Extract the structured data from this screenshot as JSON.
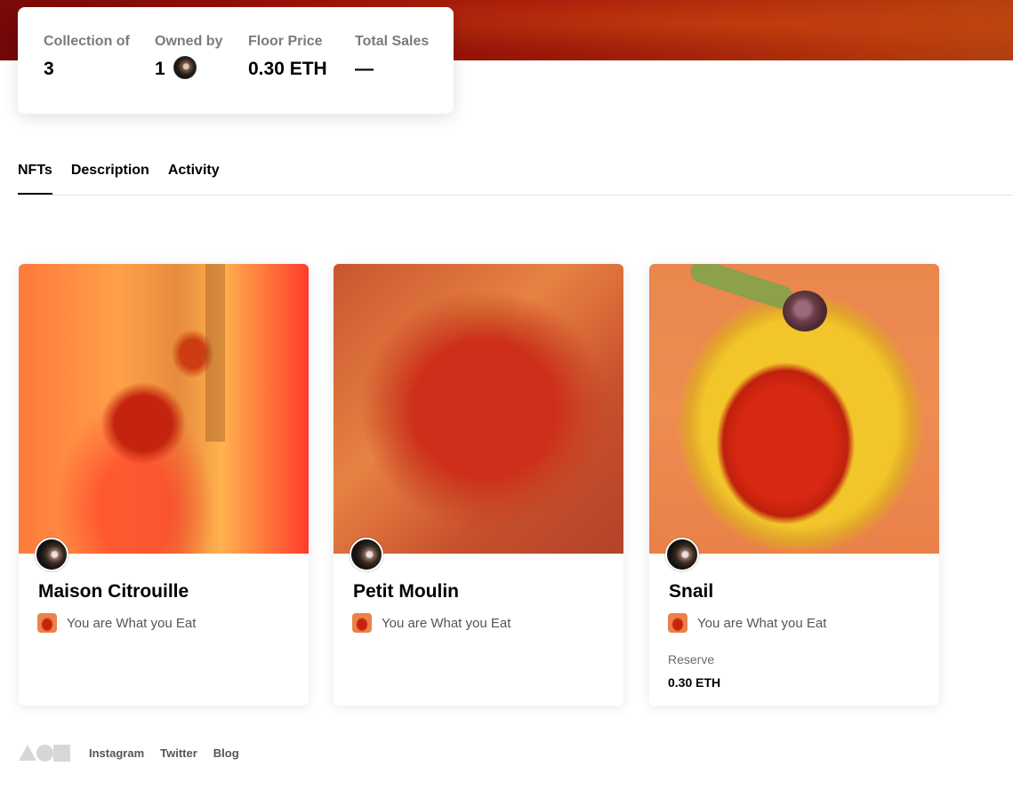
{
  "stats": {
    "collection_of": {
      "label": "Collection of",
      "value": "3"
    },
    "owned_by": {
      "label": "Owned by",
      "value": "1",
      "avatar_icon": "owner-avatar-icon"
    },
    "floor_price": {
      "label": "Floor Price",
      "value": "0.30 ETH"
    },
    "total_sales": {
      "label": "Total Sales",
      "value": "—"
    }
  },
  "tabs": [
    {
      "label": "NFTs",
      "active": true
    },
    {
      "label": "Description",
      "active": false
    },
    {
      "label": "Activity",
      "active": false
    }
  ],
  "cards": [
    {
      "title": "Maison Citrouille",
      "collection": "You are What you Eat",
      "reserve_label": "",
      "reserve_value": ""
    },
    {
      "title": "Petit Moulin",
      "collection": "You are What you Eat",
      "reserve_label": "",
      "reserve_value": ""
    },
    {
      "title": "Snail",
      "collection": "You are What you Eat",
      "reserve_label": "Reserve",
      "reserve_value": "0.30 ETH"
    }
  ],
  "footer": {
    "logo_icon": "foundation-logo-icon",
    "links": [
      "Instagram",
      "Twitter",
      "Blog"
    ]
  },
  "colors": {
    "banner": "#a81d0a",
    "text_muted": "#7b7b7b",
    "divider": "#e5e5e5"
  }
}
